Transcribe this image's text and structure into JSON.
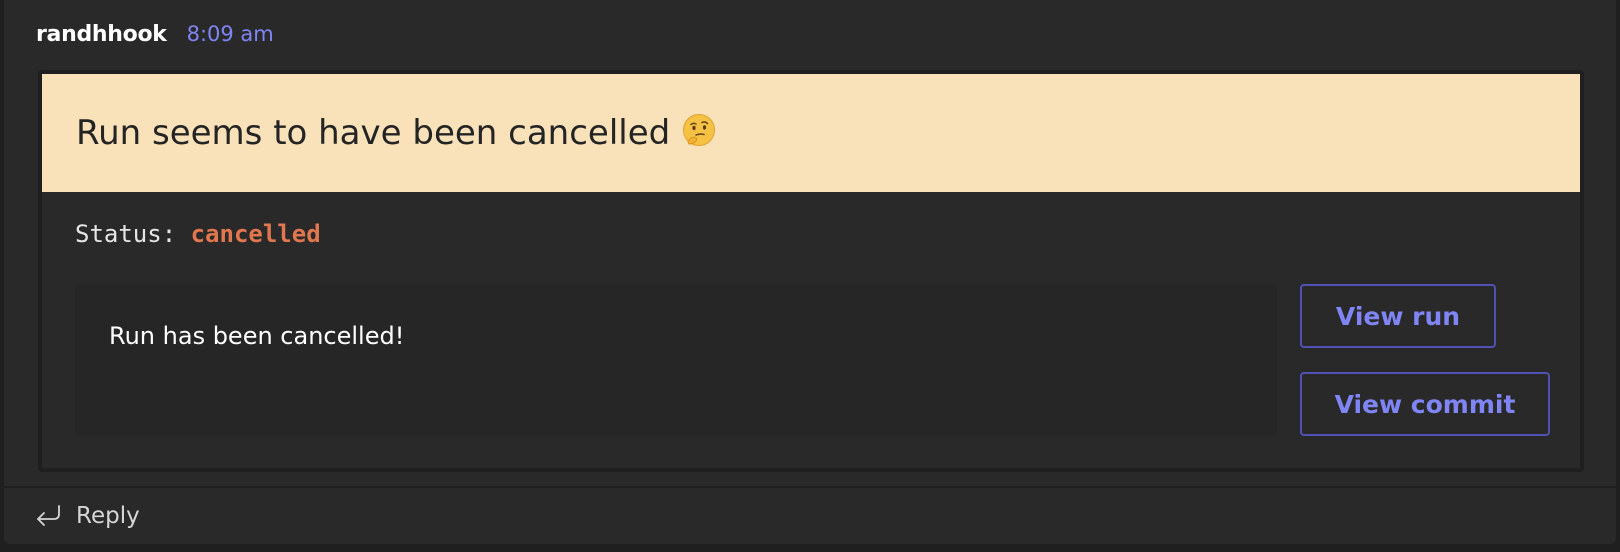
{
  "message": {
    "author": "randhhook",
    "time": "8:09 am"
  },
  "card": {
    "banner": {
      "title": "Run seems to have been cancelled",
      "emoji_icon": "thinking-face-icon",
      "background_color": "#f9e1b9"
    },
    "status": {
      "label": "Status: ",
      "value": "cancelled",
      "value_color": "#e0774e"
    },
    "message_text": "Run has been cancelled!",
    "actions": {
      "view_run_label": "View run",
      "view_commit_label": "View commit"
    }
  },
  "footer": {
    "reply_icon": "reply-arrow-icon",
    "reply_label": "Reply"
  },
  "colors": {
    "accent": "#7f85f5",
    "button_border": "#4f52b2",
    "background": "#292929"
  }
}
